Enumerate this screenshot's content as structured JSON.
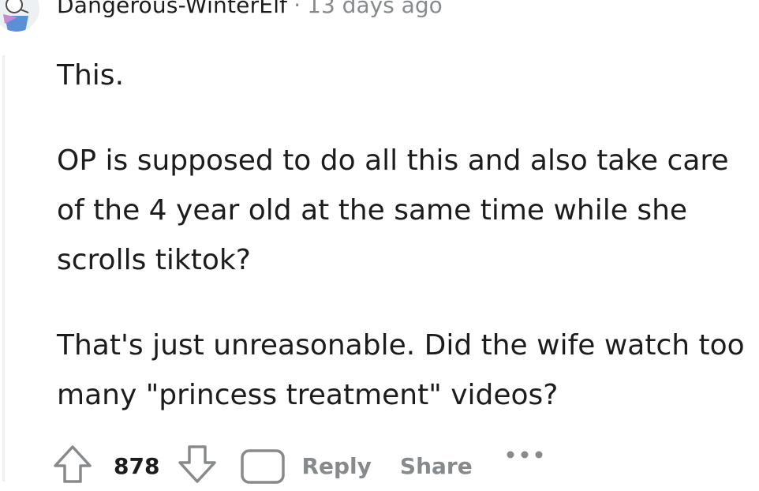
{
  "comment": {
    "username": "Dangerous-WinterElf",
    "separator": "·",
    "timestamp": "13 days ago",
    "paragraphs": [
      "This.",
      "OP is supposed to do all this and also take care of the 4 year old at the same time while she scrolls tiktok?",
      "That's just unreasonable. Did the wife watch too many \"princess treatment\" videos?"
    ]
  },
  "actions": {
    "upvote_icon": "arrow-up-icon",
    "vote_count": "878",
    "downvote_icon": "arrow-down-icon",
    "reply_icon": "comment-bubble-icon",
    "reply_label": "Reply",
    "share_label": "Share",
    "more_icon": "ellipsis-icon"
  },
  "colors": {
    "text": "#1c1c1c",
    "meta": "#878a8c",
    "thread_line": "#edeff1"
  }
}
